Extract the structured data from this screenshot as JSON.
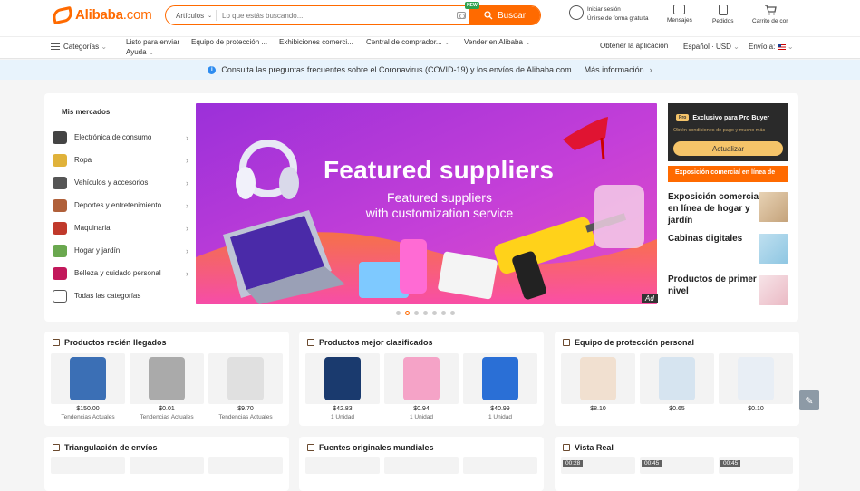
{
  "header": {
    "logo_text": "Alibaba",
    "logo_suffix": ".com",
    "search_category": "Artículos",
    "search_placeholder": "Lo que estás buscando...",
    "new_badge": "NEW",
    "search_button": "Buscar",
    "signin_line1": "Iniciar sesión",
    "signin_line2": "Únirse de forma gratuita",
    "messages": "Mensajes",
    "orders": "Pedidos",
    "cart": "Carrito de cor"
  },
  "nav": {
    "categories": "Categorías",
    "items": [
      "Listo para enviar",
      "Equipo de protección ...",
      "Exhibiciones comerci...",
      "Central de comprador...",
      "Vender en Alibaba"
    ],
    "help": "Ayuda",
    "get_app": "Obtener la aplicación",
    "language": "Español · USD",
    "ship_to": "Envío a:"
  },
  "notice": {
    "text": "Consulta las preguntas frecuentes sobre el Coronavirus (COVID-19) y los envíos de Alibaba.com",
    "more": "Más información"
  },
  "markets": {
    "title": "Mis mercados",
    "items": [
      {
        "label": "Electrónica de consumo",
        "icon": "electronics-icon"
      },
      {
        "label": "Ropa",
        "icon": "clothing-icon"
      },
      {
        "label": "Vehículos y accesorios",
        "icon": "vehicle-icon"
      },
      {
        "label": "Deportes y entretenimiento",
        "icon": "sports-icon"
      },
      {
        "label": "Maquinaria",
        "icon": "machinery-icon"
      },
      {
        "label": "Hogar y jardín",
        "icon": "home-garden-icon"
      },
      {
        "label": "Belleza y cuidado personal",
        "icon": "beauty-icon"
      },
      {
        "label": "Todas las categorías",
        "icon": "grid-icon"
      }
    ]
  },
  "banner": {
    "title": "Featured suppliers",
    "sub1": "Featured suppliers",
    "sub2": "with customization service",
    "ad": "Ad",
    "slide_count": 7,
    "active_slide": 2
  },
  "pro_buyer": {
    "badge": "Pro",
    "title": "Exclusivo para Pro Buyer",
    "desc": "Obtén condiciones de pago y mucho más",
    "button": "Actualizar"
  },
  "side": {
    "expo_bar": "Exposición comercial en línea de",
    "items": [
      "Exposición comercial en línea de hogar y jardín",
      "Cabinas digitales",
      "Productos de primer nivel"
    ]
  },
  "cards": [
    {
      "title": "Productos recién llegados",
      "products": [
        {
          "price": "$150.00",
          "sub": "Tendencias Actuales"
        },
        {
          "price": "$0.01",
          "sub": "Tendencias Actuales"
        },
        {
          "price": "$9.70",
          "sub": "Tendencias Actuales"
        }
      ]
    },
    {
      "title": "Productos mejor clasificados",
      "products": [
        {
          "price": "$42.83",
          "sub": "1 Unidad"
        },
        {
          "price": "$0.94",
          "sub": "1 Unidad"
        },
        {
          "price": "$40.99",
          "sub": "1 Unidad"
        }
      ]
    },
    {
      "title": "Equipo de protección personal",
      "products": [
        {
          "price": "$8.10",
          "sub": ""
        },
        {
          "price": "$0.65",
          "sub": ""
        },
        {
          "price": "$0.10",
          "sub": ""
        }
      ]
    }
  ],
  "cards2": [
    {
      "title": "Triangulación de envíos"
    },
    {
      "title": "Fuentes originales mundiales"
    },
    {
      "title": "Vista Real",
      "videos": [
        "00:28",
        "00:45",
        "00:45"
      ]
    }
  ],
  "colors": {
    "accent": "#ff6a00",
    "notice_bg": "#e8f3fc"
  }
}
